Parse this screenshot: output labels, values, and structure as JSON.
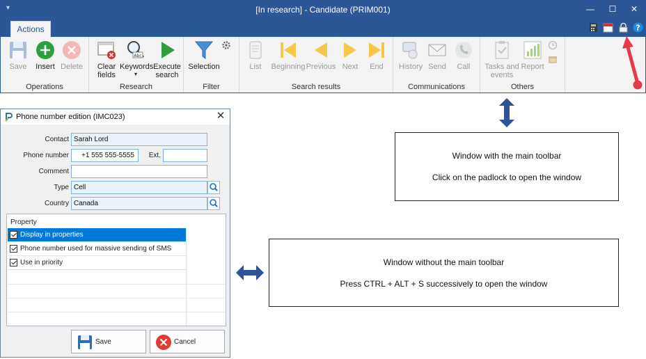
{
  "window": {
    "title": "[In research] - Candidate (PRIM001)",
    "tab": "Actions",
    "minimize": "—",
    "maximize": "☐",
    "close": "✕"
  },
  "ribbon": {
    "groups": {
      "operations": "Operations",
      "research": "Research",
      "filter": "Filter",
      "search_results": "Search results",
      "communications": "Communications",
      "others": "Others"
    },
    "buttons": {
      "save": "Save",
      "insert": "Insert",
      "delete": "Delete",
      "clear_1": "Clear",
      "clear_2": "fields",
      "keywords": "Keywords",
      "execute_1": "Execute",
      "execute_2": "search",
      "selection": "Selection",
      "list": "List",
      "beginning": "Beginning",
      "previous": "Previous",
      "next": "Next",
      "end": "End",
      "history": "History",
      "send": "Send",
      "call": "Call",
      "tasks_1": "Tasks and",
      "tasks_2": "events",
      "report": "Report"
    }
  },
  "dialog": {
    "title": "Phone number edition (IMC023)",
    "labels": {
      "contact": "Contact",
      "phone": "Phone number",
      "ext": "Ext.",
      "comment": "Comment",
      "type": "Type",
      "country": "Country"
    },
    "values": {
      "contact": "Sarah Lord",
      "phone": "+1 555 555-5555",
      "ext": "",
      "comment": "",
      "type": "Cell",
      "country": "Canada"
    },
    "grid": {
      "header": "Property",
      "rows": [
        {
          "label": "Display in properties",
          "checked": true
        },
        {
          "label": "Phone number used for massive sending of SMS",
          "checked": true
        },
        {
          "label": "Use in priority",
          "checked": true
        }
      ]
    },
    "save": "Save",
    "cancel": "Cancel"
  },
  "notes": {
    "top_line1": "Window with the main toolbar",
    "top_line2": "Click on the padlock to open the window",
    "bottom_line1": "Window without the main toolbar",
    "bottom_line2": "Press CTRL + ALT + S successively to open the window"
  },
  "colors": {
    "titlebar": "#2b5797",
    "selection": "#0078d7",
    "annotation_arrow_blue": "#2f5597",
    "annotation_arrow_red": "#e8394a"
  }
}
